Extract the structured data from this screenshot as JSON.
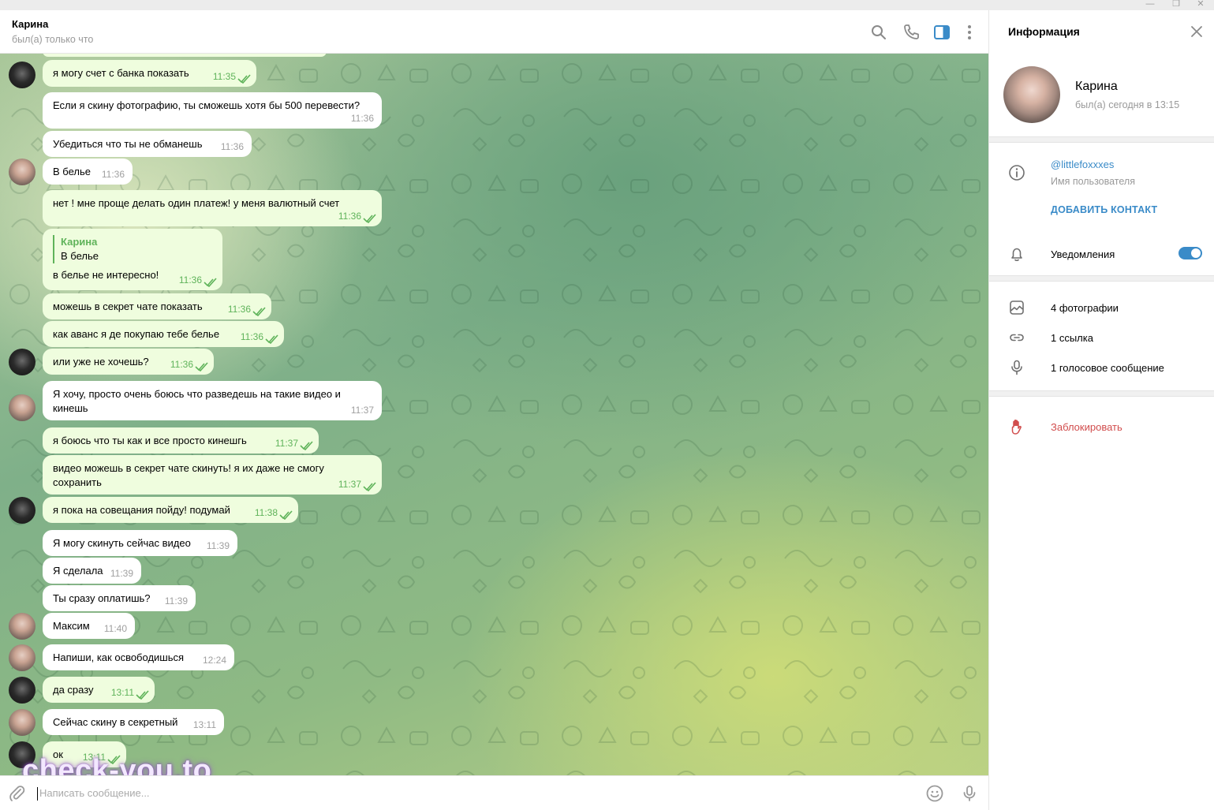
{
  "window": {
    "controls": [
      "—",
      "❐",
      "✕"
    ]
  },
  "header": {
    "title": "Карина",
    "status": "был(а) только что"
  },
  "messages": [
    {
      "dir": "out",
      "avatar": "dark",
      "text": "я могу счет с банка показать",
      "time": "11:35"
    },
    {
      "dir": "in",
      "avatar": "",
      "text": "Если я скину фотографию, ты сможешь хотя бы 500 перевести?",
      "time": "11:36"
    },
    {
      "dir": "in",
      "avatar": "",
      "text": "Убедиться что ты не обманешь",
      "time": "11:36"
    },
    {
      "dir": "in",
      "avatar": "girl",
      "text": "В белье",
      "time": "11:36"
    },
    {
      "dir": "out",
      "avatar": "",
      "text": "нет ! мне проще делать один платеж! у меня валютный счет",
      "time": "11:36"
    },
    {
      "dir": "out",
      "avatar": "",
      "reply_name": "Карина",
      "reply_text": "В белье",
      "text": "в белье не интересно!",
      "time": "11:36"
    },
    {
      "dir": "out",
      "avatar": "",
      "text": "можешь в секрет чате показать",
      "time": "11:36"
    },
    {
      "dir": "out",
      "avatar": "",
      "text": "как аванс я де покупаю тебе белье",
      "time": "11:36"
    },
    {
      "dir": "out",
      "avatar": "dark",
      "text": "или уже не хочешь?",
      "time": "11:36"
    },
    {
      "dir": "in",
      "avatar": "girl",
      "text": "Я хочу, просто очень боюсь что разведешь на такие видео и кинешь",
      "time": "11:37"
    },
    {
      "dir": "out",
      "avatar": "",
      "text": "я боюсь что ты как и все просто кинешгь",
      "time": "11:37"
    },
    {
      "dir": "out",
      "avatar": "",
      "text": "видео можешь в секрет чате скинуть! я их даже не смогу сохранить",
      "time": "11:37"
    },
    {
      "dir": "out",
      "avatar": "dark",
      "text": "я пока на совещания пойду! подумай",
      "time": "11:38"
    },
    {
      "dir": "in",
      "avatar": "",
      "text": "Я могу скинуть сейчас видео",
      "time": "11:39"
    },
    {
      "dir": "in",
      "avatar": "",
      "text": "Я сделала",
      "time": "11:39"
    },
    {
      "dir": "in",
      "avatar": "",
      "text": "Ты сразу оплатишь?",
      "time": "11:39"
    },
    {
      "dir": "in",
      "avatar": "girl",
      "text": "Максим",
      "time": "11:40"
    },
    {
      "dir": "in",
      "avatar": "girl",
      "text": "Напиши, как освободишься",
      "time": "12:24"
    },
    {
      "dir": "out",
      "avatar": "dark",
      "text": "да сразу",
      "time": "13:11"
    },
    {
      "dir": "in",
      "avatar": "girl",
      "text": "Сейчас скину в секретный",
      "time": "13:11"
    },
    {
      "dir": "out",
      "avatar": "dark",
      "text": "ок",
      "time": "13:11"
    }
  ],
  "composer": {
    "placeholder": "Написать сообщение..."
  },
  "watermark": "check-you.to",
  "info": {
    "title": "Информация",
    "name": "Карина",
    "status": "был(а) сегодня в 13:15",
    "username": "@littlefoxxxes",
    "username_caption": "Имя пользователя",
    "add_contact": "ДОБАВИТЬ КОНТАКТ",
    "notifications_label": "Уведомления",
    "notifications_on": true,
    "photos": "4 фотографии",
    "links": "1 ссылка",
    "voice": "1 голосовое сообщение",
    "block": "Заблокировать"
  },
  "colors": {
    "accent": "#3a8bc8",
    "outgoing_bubble": "#effdde",
    "tick_green": "#5fb35a",
    "danger": "#d14d4d"
  },
  "icons": [
    "search-icon",
    "phone-icon",
    "sidebar-toggle-icon",
    "more-vertical-icon",
    "close-icon",
    "info-icon",
    "bell-icon",
    "photo-icon",
    "link-icon",
    "microphone-icon",
    "hand-block-icon",
    "paperclip-icon",
    "emoji-icon"
  ]
}
